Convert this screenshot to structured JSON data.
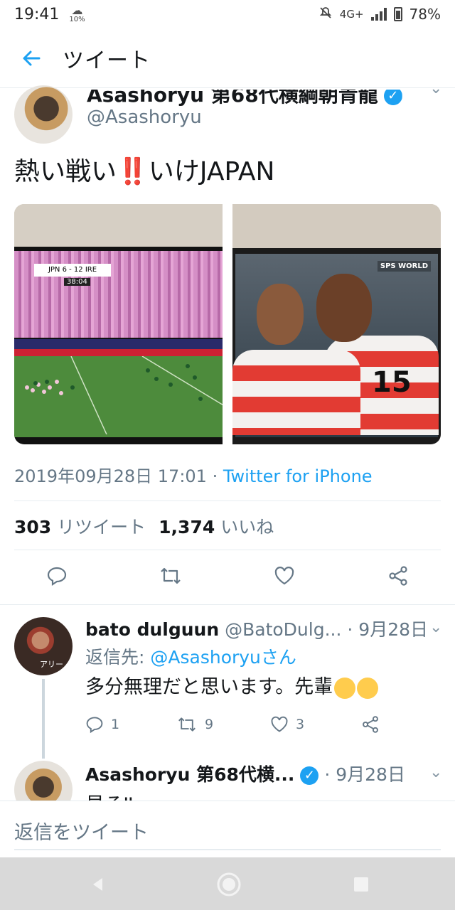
{
  "status_bar": {
    "time": "19:41",
    "weather_pct": "10%",
    "network": "4G+",
    "battery": "78%"
  },
  "header": {
    "title": "ツイート"
  },
  "tweet": {
    "author_name": "Asashoryu 第68代横綱朝青龍",
    "author_handle": "@Asashoryu",
    "text": "熱い戦い",
    "text_emoji": "‼️",
    "text_tail": "いけJAPAN",
    "photos": [
      {
        "scoreboard": "JPN  6 - 12  IRE",
        "clock": "38:04"
      },
      {
        "broadcaster": "SPS WORLD",
        "jersey_number": "15"
      }
    ],
    "timestamp": "2019年09月28日 17:01",
    "separator": " · ",
    "source": "Twitter for iPhone",
    "retweet_count": "303",
    "retweet_label": "リツイート",
    "like_count": "1,374",
    "like_label": "いいね"
  },
  "replies": [
    {
      "name": "bato dulguun",
      "handle": "@BatoDulg...",
      "date": "· 9月28日",
      "reply_to_label": "返信先: ",
      "reply_to_handle": "@Asashoryuさん",
      "text": "多分無理だと思います。先輩",
      "avatar_tag": "アリー",
      "reply_count": "1",
      "retweet_count": "9",
      "like_count": "3"
    },
    {
      "name": "Asashoryu 第68代横...",
      "date": "· 9月28日",
      "text": "見る‼"
    }
  ],
  "compose": {
    "placeholder": "返信をツイート"
  },
  "colors": {
    "accent": "#1da1f2",
    "muted": "#657786",
    "text": "#14171a"
  }
}
